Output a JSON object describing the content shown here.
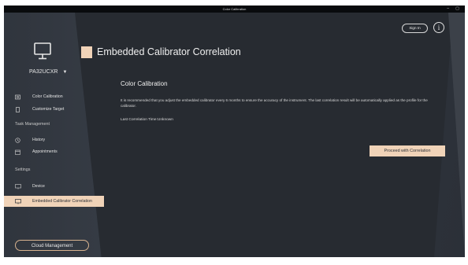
{
  "window": {
    "title": "Color Calibration",
    "minimize": "–",
    "close": "▢"
  },
  "device": {
    "name": "PA32UCXR",
    "icon": "monitor-icon"
  },
  "sidebar": {
    "items": [
      {
        "label": "Color Calibration",
        "icon": "calibration-icon"
      },
      {
        "label": "Customize Target",
        "icon": "target-icon"
      }
    ],
    "task_management": {
      "label": "Task Management",
      "items": [
        {
          "label": "History",
          "icon": "history-icon"
        },
        {
          "label": "Appointments",
          "icon": "calendar-icon"
        }
      ]
    },
    "settings": {
      "label": "Settings",
      "items": [
        {
          "label": "Device",
          "icon": "monitor-icon"
        },
        {
          "label": "Embedded Calibrator Correlation",
          "icon": "monitor-icon",
          "active": true
        }
      ]
    },
    "cloud_button": "Cloud Management"
  },
  "header": {
    "page_title": "Embedded Calibrator Correlation",
    "sign_in": "Sign In",
    "info_icon": "info-icon"
  },
  "content": {
    "section_title": "Color Calibration",
    "description": "It is recommended that you adjust the embedded calibrator every 6 months to ensure the accuracy of the instrument. The last correlation result will be automatically applied as the profile for the calibrator.",
    "last_correlation": "Last Correlation Time:Unknown",
    "proceed_button": "Proceed with Correlation"
  },
  "colors": {
    "accent": "#f0d3b8",
    "background": "#2a2f37"
  }
}
